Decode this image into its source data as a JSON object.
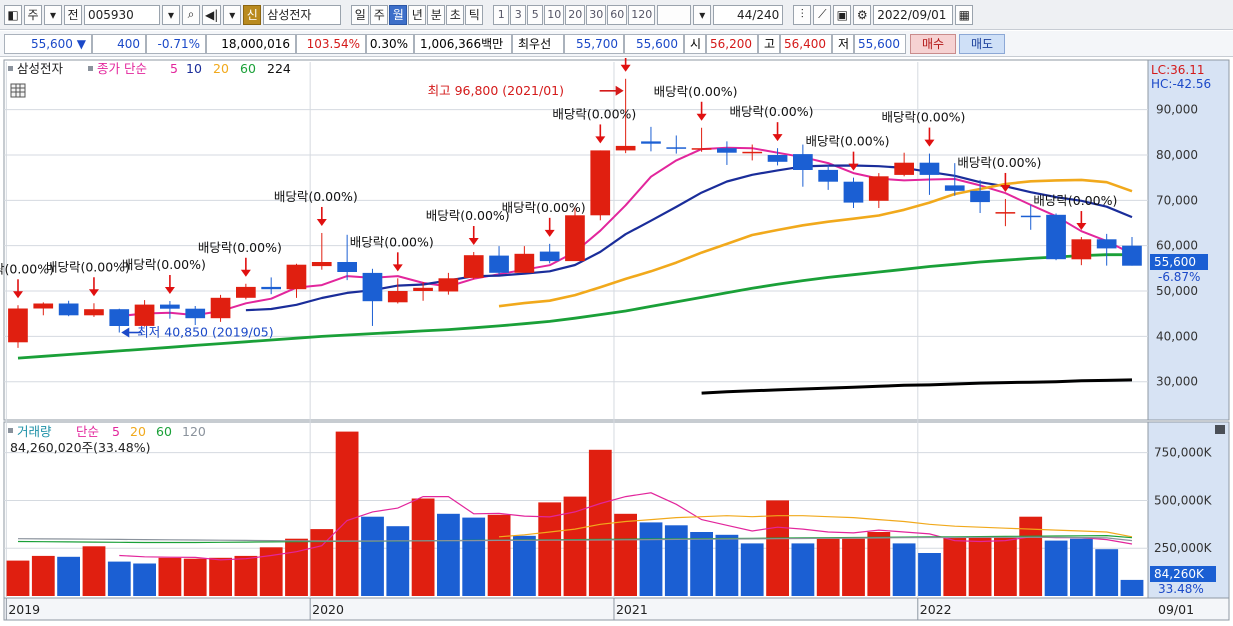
{
  "toolbar": {
    "left_items": [
      {
        "name": "window-icon",
        "text": "◧"
      },
      {
        "name": "market-type-select",
        "text": "주"
      },
      {
        "name": "market-type-dropdown",
        "text": "▾"
      },
      {
        "name": "all-button",
        "text": "전"
      }
    ],
    "stock_code": "005930",
    "stock_name": "삼성전자",
    "sin_label": "신",
    "periods": [
      "일",
      "주",
      "월",
      "년",
      "분",
      "초",
      "틱"
    ],
    "active_period": "월",
    "intervals": [
      "1",
      "3",
      "5",
      "10",
      "20",
      "30",
      "60",
      "120"
    ],
    "count": "44",
    "total": "/240",
    "date": "2022/09/01"
  },
  "pricebar": {
    "price": "55,600",
    "change_arrow": "▼",
    "change": "400",
    "change_pct": "-0.71%",
    "volume": "18,000,016",
    "vol_ratio": "103.54%",
    "turnover_rate": "0.30%",
    "trade_value": "1,006,366백만",
    "best_bid_label": "최우선",
    "best_ask": "55,700",
    "best_bid": "55,600",
    "open_label": "시",
    "open": "56,200",
    "high_label": "고",
    "high": "56,400",
    "low_label": "저",
    "low": "55,600",
    "buy_label": "매수",
    "sell_label": "매도"
  },
  "price_panel": {
    "legend_name": "삼성전자",
    "legend_close": "종가 단순",
    "ma_labels": [
      "5",
      "10",
      "20",
      "60",
      "224"
    ],
    "lc_label": "LC:36.11",
    "hc_label": "HC:-42.56",
    "current_price_label": "55,600",
    "current_pct_label": "-6.87%",
    "high_annotation": "최고 96,800 (2021/01)",
    "low_annotation": "최저 40,850 (2019/05)",
    "dividend_label": "배당락(0.00%)"
  },
  "volume_panel": {
    "legend_name": "거래량",
    "legend_type": "단순",
    "ma_labels": [
      "5",
      "20",
      "60",
      "120"
    ],
    "value_text": "84,260,020주(33.48%)",
    "current_label": "84,260K",
    "current_pct": "33.48%"
  },
  "x_axis": {
    "labels": [
      "2019",
      "2020",
      "2021",
      "2022",
      "09/01"
    ]
  },
  "colors": {
    "up": "#e01f10",
    "down": "#1b5fd3",
    "ma5": "#e2269c",
    "ma10": "#1a2d9a",
    "ma20": "#f1a91c",
    "ma60": "#1aa038",
    "ma224": "#000000"
  },
  "chart_data": [
    {
      "type": "candlestick",
      "title": "삼성전자",
      "x": [
        "2019/01",
        "2019/02",
        "2019/03",
        "2019/04",
        "2019/05",
        "2019/06",
        "2019/07",
        "2019/08",
        "2019/09",
        "2019/10",
        "2019/11",
        "2019/12",
        "2020/01",
        "2020/02",
        "2020/03",
        "2020/04",
        "2020/05",
        "2020/06",
        "2020/07",
        "2020/08",
        "2020/09",
        "2020/10",
        "2020/11",
        "2020/12",
        "2021/01",
        "2021/02",
        "2021/03",
        "2021/04",
        "2021/05",
        "2021/06",
        "2021/07",
        "2021/08",
        "2021/09",
        "2021/10",
        "2021/11",
        "2021/12",
        "2022/01",
        "2022/02",
        "2022/03",
        "2022/04",
        "2022/05",
        "2022/06",
        "2022/07",
        "2022/08",
        "2022/09"
      ],
      "open": [
        38700,
        46150,
        47250,
        44650,
        46000,
        42300,
        47000,
        46100,
        44000,
        48500,
        50900,
        50400,
        55500,
        56400,
        54000,
        47500,
        50000,
        49900,
        52900,
        57800,
        54000,
        58700,
        56600,
        66700,
        81000,
        83000,
        81700,
        81400,
        81500,
        80500,
        80000,
        80200,
        76700,
        74100,
        69900,
        75600,
        78300,
        73300,
        72100,
        67400,
        66600,
        66800,
        57000,
        61400,
        60000
      ],
      "high": [
        46850,
        47500,
        47850,
        47300,
        46100,
        48000,
        47800,
        46700,
        49150,
        51600,
        53000,
        56000,
        62800,
        62400,
        54900,
        52800,
        52000,
        54000,
        58600,
        59900,
        59900,
        60400,
        68500,
        81000,
        96800,
        86200,
        84300,
        86000,
        83000,
        82300,
        81500,
        82300,
        77700,
        75000,
        76000,
        80500,
        80300,
        78200,
        74500,
        70300,
        69000,
        67100,
        61900,
        62600,
        61900
      ],
      "low": [
        37450,
        44650,
        44450,
        44300,
        40850,
        42150,
        43900,
        42500,
        43200,
        48150,
        49300,
        48500,
        54700,
        52400,
        42300,
        47250,
        47850,
        49200,
        52600,
        53600,
        54000,
        56100,
        56800,
        65600,
        80400,
        80800,
        80300,
        80700,
        77800,
        78800,
        77700,
        73000,
        72300,
        68300,
        68300,
        75300,
        71200,
        71000,
        67200,
        64300,
        63500,
        56800,
        55700,
        55600,
        55600
      ],
      "close": [
        46150,
        47250,
        44650,
        46000,
        42300,
        47000,
        46100,
        44000,
        48500,
        50900,
        50400,
        55800,
        56400,
        54200,
        47750,
        50000,
        50700,
        52800,
        57900,
        54000,
        58200,
        56600,
        66700,
        81000,
        82000,
        82500,
        81400,
        81500,
        80500,
        80700,
        78500,
        76700,
        74100,
        69500,
        75300,
        78300,
        75600,
        72100,
        69600,
        67400,
        66500,
        57000,
        61400,
        59400,
        55600
      ],
      "ma_series": [
        {
          "name": "5",
          "values": [
            null,
            null,
            null,
            null,
            44470,
            45040,
            45210,
            44680,
            45580,
            47300,
            48310,
            50760,
            51300,
            53300,
            52900,
            53300,
            51800,
            51000,
            52700,
            53700,
            54700,
            55700,
            58600,
            63300,
            68900,
            75200,
            78800,
            81300,
            81600,
            81500,
            80500,
            79500,
            78200,
            76000,
            74800,
            74400,
            74600,
            74700,
            73300,
            71600,
            69000,
            66500,
            63200,
            61000,
            58200
          ]
        },
        {
          "name": "10",
          "values": [
            null,
            null,
            null,
            null,
            null,
            null,
            null,
            null,
            null,
            45760,
            46040,
            46970,
            48470,
            49590,
            50180,
            51200,
            51440,
            52330,
            53260,
            53400,
            53850,
            54350,
            55740,
            58620,
            62520,
            65510,
            68540,
            71700,
            74160,
            75630,
            76590,
            77470,
            77650,
            77670,
            77530,
            77140,
            76260,
            75400,
            74000,
            73100,
            71800,
            70700,
            69900,
            68600,
            66300
          ]
        },
        {
          "name": "20",
          "values": [
            null,
            null,
            null,
            null,
            null,
            null,
            null,
            null,
            null,
            null,
            null,
            null,
            null,
            null,
            null,
            null,
            null,
            null,
            null,
            46650,
            47330,
            47860,
            49100,
            50810,
            52680,
            54350,
            56270,
            58470,
            60400,
            62350,
            63460,
            64500,
            65280,
            65940,
            66650,
            67900,
            69500,
            71400,
            72500,
            73600,
            74200,
            74400,
            74500,
            74000,
            72000
          ]
        },
        {
          "name": "60",
          "values": [
            35200,
            35600,
            36000,
            36400,
            36800,
            37200,
            37600,
            38000,
            38400,
            38800,
            39200,
            39600,
            40000,
            40300,
            40600,
            40900,
            41200,
            41500,
            41900,
            42300,
            42800,
            43300,
            44000,
            44800,
            45600,
            46600,
            47600,
            48600,
            49600,
            50600,
            51500,
            52300,
            53000,
            53600,
            54200,
            54800,
            55400,
            55900,
            56400,
            56800,
            57200,
            57500,
            57800,
            58000,
            58000
          ]
        },
        {
          "name": "224",
          "values": [
            null,
            null,
            null,
            null,
            null,
            null,
            null,
            null,
            null,
            null,
            null,
            null,
            null,
            null,
            null,
            null,
            null,
            null,
            null,
            null,
            null,
            null,
            null,
            null,
            null,
            null,
            null,
            27500,
            27800,
            28000,
            28200,
            28400,
            28600,
            28800,
            29000,
            29200,
            29300,
            29500,
            29700,
            29800,
            29900,
            30000,
            30200,
            30300,
            30400
          ]
        }
      ],
      "y_ticks": [
        30000,
        40000,
        50000,
        60000,
        70000,
        80000,
        90000
      ],
      "ylim": [
        22000,
        100500
      ],
      "dividend_months": [
        "2019/01",
        "2019/04",
        "2019/07",
        "2019/10",
        "2020/01",
        "2020/04",
        "2020/07",
        "2020/10",
        "2020/12",
        "2021/01",
        "2021/04",
        "2021/07",
        "2021/10",
        "2022/01",
        "2022/04",
        "2022/07"
      ],
      "annotations": [
        {
          "text": "최고 96,800 (2021/01)",
          "x": "2021/01",
          "y": 96800
        },
        {
          "text": "최저 40,850 (2019/05)",
          "x": "2019/05",
          "y": 40850
        }
      ]
    },
    {
      "type": "bar",
      "title": "거래량",
      "x": [
        "2019/01",
        "2019/02",
        "2019/03",
        "2019/04",
        "2019/05",
        "2019/06",
        "2019/07",
        "2019/08",
        "2019/09",
        "2019/10",
        "2019/11",
        "2019/12",
        "2020/01",
        "2020/02",
        "2020/03",
        "2020/04",
        "2020/05",
        "2020/06",
        "2020/07",
        "2020/08",
        "2020/09",
        "2020/10",
        "2020/11",
        "2020/12",
        "2021/01",
        "2021/02",
        "2021/03",
        "2021/04",
        "2021/05",
        "2021/06",
        "2021/07",
        "2021/08",
        "2021/09",
        "2021/10",
        "2021/11",
        "2021/12",
        "2022/01",
        "2022/02",
        "2022/03",
        "2022/04",
        "2022/05",
        "2022/06",
        "2022/07",
        "2022/08",
        "2022/09"
      ],
      "values": [
        185000,
        210000,
        205000,
        260000,
        180000,
        170000,
        200000,
        195000,
        200000,
        210000,
        255000,
        300000,
        350000,
        860000,
        415000,
        365000,
        510000,
        430000,
        410000,
        425000,
        315000,
        490000,
        520000,
        765000,
        430000,
        385000,
        370000,
        335000,
        320000,
        275000,
        500000,
        275000,
        300000,
        300000,
        335000,
        275000,
        225000,
        305000,
        305000,
        305000,
        415000,
        290000,
        300000,
        245000,
        84260
      ],
      "colors": [
        "up",
        "up",
        "down",
        "up",
        "down",
        "down",
        "up",
        "up",
        "up",
        "up",
        "up",
        "up",
        "up",
        "up",
        "down",
        "down",
        "up",
        "down",
        "down",
        "up",
        "down",
        "up",
        "up",
        "up",
        "up",
        "down",
        "down",
        "down",
        "down",
        "down",
        "up",
        "down",
        "up",
        "up",
        "up",
        "down",
        "down",
        "up",
        "up",
        "up",
        "up",
        "down",
        "down",
        "down",
        "down"
      ],
      "ma_series": [
        {
          "name": "5",
          "values": [
            null,
            null,
            null,
            null,
            212000,
            205000,
            203000,
            202000,
            189000,
            195000,
            212000,
            232000,
            263000,
            395000,
            440000,
            460000,
            520000,
            520000,
            430000,
            432000,
            418000,
            414000,
            440000,
            484000,
            520000,
            540000,
            480000,
            400000,
            370000,
            340000,
            360000,
            350000,
            335000,
            330000,
            345000,
            335000,
            325000,
            290000,
            285000,
            290000,
            310000,
            305000,
            305000,
            295000,
            272000
          ]
        },
        {
          "name": "20",
          "values": [
            null,
            null,
            null,
            null,
            null,
            null,
            null,
            null,
            null,
            null,
            null,
            null,
            null,
            null,
            null,
            null,
            null,
            null,
            null,
            310000,
            320000,
            335000,
            350000,
            375000,
            390000,
            400000,
            410000,
            415000,
            420000,
            415000,
            420000,
            420000,
            415000,
            410000,
            400000,
            390000,
            375000,
            365000,
            360000,
            355000,
            350000,
            345000,
            340000,
            335000,
            310000
          ]
        },
        {
          "name": "60",
          "values": [
            285000,
            284000,
            283000,
            282000,
            281000,
            280000,
            280000,
            280000,
            281000,
            282000,
            283000,
            284000,
            285000,
            286000,
            287000,
            288000,
            289000,
            290000,
            291000,
            292000,
            293000,
            294000,
            295000,
            296000,
            297000,
            298000,
            299000,
            300000,
            301000,
            302000,
            303000,
            304000,
            305000,
            306000,
            307000,
            308000,
            309000,
            310000,
            311000,
            312000,
            313000,
            314000,
            315000,
            316000,
            305000
          ]
        },
        {
          "name": "120",
          "values": [
            300000,
            299000,
            298000,
            297000,
            296000,
            295000,
            294000,
            293000,
            292000,
            291000,
            290000,
            289000,
            288000,
            288000,
            288000,
            289000,
            289000,
            290000,
            290000,
            291000,
            291000,
            292000,
            292000,
            293000,
            294000,
            295000,
            296000,
            297000,
            298000,
            299000,
            300000,
            301000,
            302000,
            303000,
            304000,
            305000,
            306000,
            306000,
            307000,
            307000,
            307000,
            307000,
            306000,
            304000,
            290000
          ]
        }
      ],
      "y_ticks": [
        250000,
        500000,
        750000
      ],
      "y_tick_labels": [
        "250,000K",
        "500,000K",
        "750,000K"
      ],
      "ylim": [
        0,
        900000
      ]
    }
  ]
}
